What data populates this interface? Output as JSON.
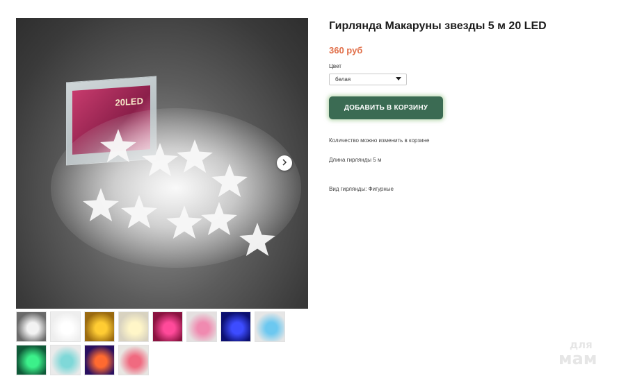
{
  "product": {
    "title": "Гирлянда Макаруны звезды 5 м 20 LED",
    "price": "360 руб",
    "color_label": "Цвет",
    "color_selected": "белая",
    "add_to_cart": "ДОБАВИТЬ В КОРЗИНУ",
    "qty_note": "Количество можно изменить в корзине",
    "length": "Длина гирлянды 5 м",
    "type": "Вид гирлянды: Фигурные"
  },
  "main_image": {
    "box_label": "20LED"
  },
  "thumbnails": [
    {
      "color": "#6a6a6a",
      "accent": "#f2f2f2"
    },
    {
      "color": "#eeeeee",
      "accent": "#ffffff"
    },
    {
      "color": "#9a6a10",
      "accent": "#ffcc33"
    },
    {
      "color": "#d8d2c0",
      "accent": "#fff6c8"
    },
    {
      "color": "#8a1340",
      "accent": "#ff4a9a"
    },
    {
      "color": "#e4e0e0",
      "accent": "#f08ab0"
    },
    {
      "color": "#0b0f70",
      "accent": "#3d4cff"
    },
    {
      "color": "#e6e6e6",
      "accent": "#6cc8f0"
    },
    {
      "color": "#0f5a38",
      "accent": "#3cf08a"
    },
    {
      "color": "#eaeaea",
      "accent": "#7fd8d8"
    },
    {
      "color": "#2a1060",
      "accent": "#ff6a30"
    },
    {
      "color": "#e8e6e2",
      "accent": "#f06a80"
    }
  ],
  "watermark": {
    "top": "для",
    "bottom": "мам"
  },
  "colors": {
    "accent_price": "#e1704a",
    "cart_button": "#3b6b53"
  }
}
